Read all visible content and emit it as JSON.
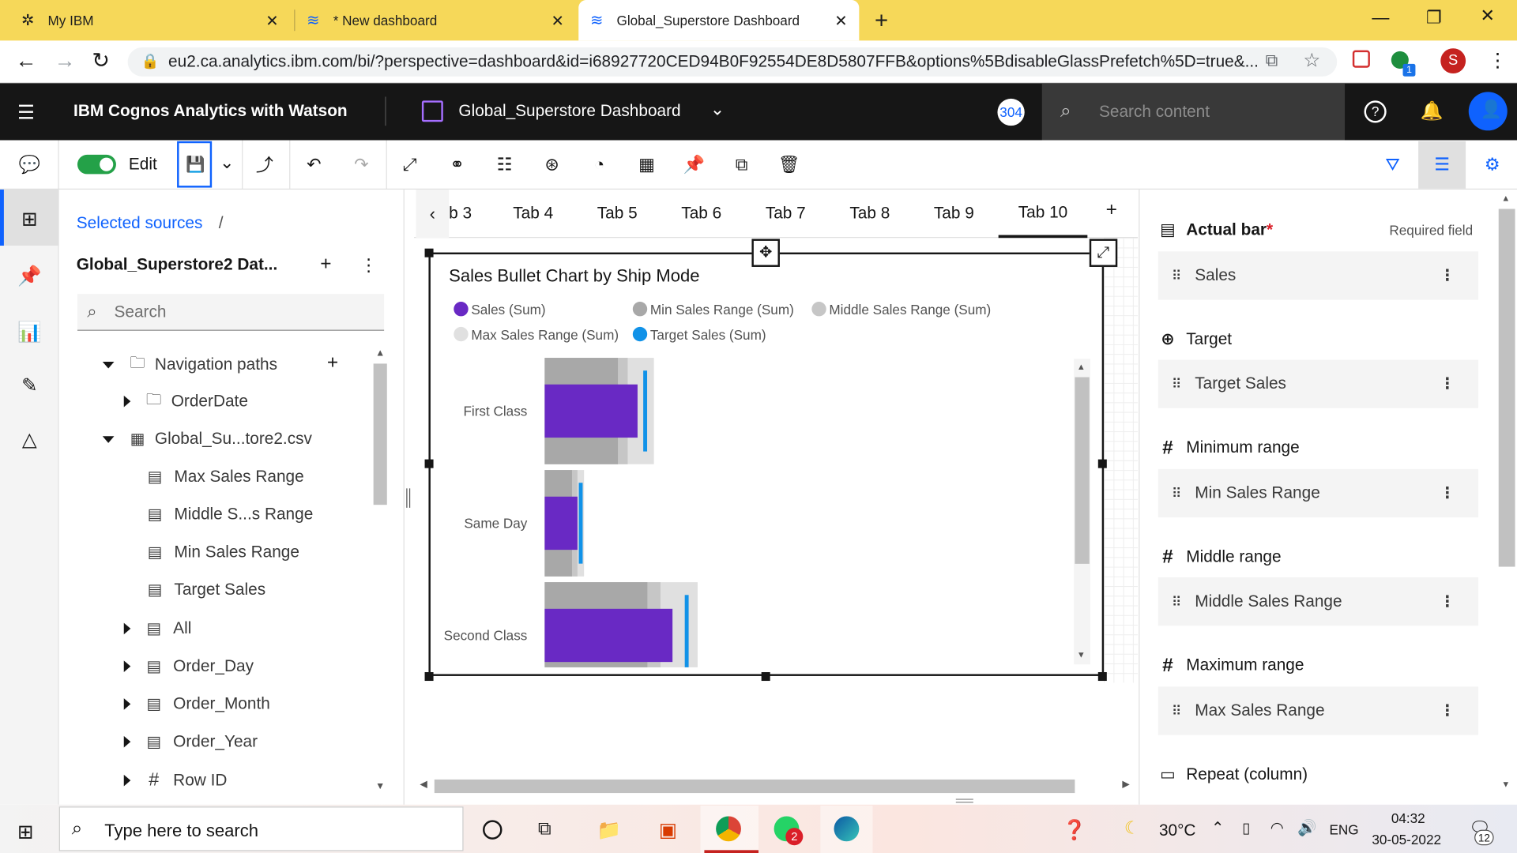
{
  "browser": {
    "tabs": [
      {
        "title": "My IBM"
      },
      {
        "title": "* New dashboard"
      },
      {
        "title": "Global_Superstore Dashboard"
      }
    ],
    "url": "eu2.ca.analytics.ibm.com/bi/?perspective=dashboard&id=i68927720CED94B0F92554DE8D5807FFB&options%5BdisableGlassPrefetch%5D=true&...",
    "profile_initial": "S",
    "extension_badge": "1"
  },
  "app": {
    "product_name": "IBM Cognos Analytics with Watson",
    "dashboard_title": "Global_Superstore Dashboard",
    "user_badge": "304",
    "search_placeholder": "Search content"
  },
  "toolbar": {
    "edit_label": "Edit",
    "edit_toggle_on": true
  },
  "data_panel": {
    "breadcrumb": "Selected sources",
    "breadcrumb_sep": "/",
    "source_title": "Global_Superstore2 Dat...",
    "search_placeholder": "Search",
    "tree": [
      {
        "label": "Navigation paths",
        "icon": "folder-icon",
        "expanded": true,
        "level": 0
      },
      {
        "label": "OrderDate",
        "icon": "folder-icon",
        "expanded": false,
        "level": 1
      },
      {
        "label": "Global_Su...tore2.csv",
        "icon": "table-icon",
        "expanded": true,
        "level": 0
      },
      {
        "label": "Max Sales Range",
        "icon": "calc-icon",
        "level": 2
      },
      {
        "label": "Middle S...s Range",
        "icon": "calc-icon",
        "level": 2
      },
      {
        "label": "Min Sales Range",
        "icon": "calc-icon",
        "level": 2
      },
      {
        "label": "Target Sales",
        "icon": "calc-icon",
        "level": 2
      },
      {
        "label": "All",
        "icon": "calc-icon",
        "expanded": false,
        "level": 1
      },
      {
        "label": "Order_Day",
        "icon": "calc-icon",
        "expanded": false,
        "level": 1
      },
      {
        "label": "Order_Month",
        "icon": "calc-icon",
        "expanded": false,
        "level": 1
      },
      {
        "label": "Order_Year",
        "icon": "calc-icon",
        "expanded": false,
        "level": 1
      },
      {
        "label": "Row ID",
        "icon": "hash-icon",
        "expanded": false,
        "level": 1
      }
    ]
  },
  "dashboard_tabs": {
    "partial_first": "b 3",
    "tabs": [
      "Tab 4",
      "Tab 5",
      "Tab 6",
      "Tab 7",
      "Tab 8",
      "Tab 9",
      "Tab 10"
    ],
    "active": "Tab 10"
  },
  "widget": {
    "title": "Sales Bullet Chart by Ship Mode",
    "legend": [
      {
        "label": "Sales (Sum)",
        "color": "#6929c4"
      },
      {
        "label": "Min Sales Range (Sum)",
        "color": "#a8a8a8"
      },
      {
        "label": "Middle Sales Range (Sum)",
        "color": "#c6c6c6"
      },
      {
        "label": "Max Sales Range (Sum)",
        "color": "#e0e0e0"
      },
      {
        "label": "Target Sales (Sum)",
        "color": "#1192e8"
      }
    ]
  },
  "chart_data": {
    "type": "bar",
    "subtype": "bullet",
    "orientation": "horizontal",
    "title": "Sales Bullet Chart by Ship Mode",
    "categories": [
      "First Class",
      "Same Day",
      "Second Class"
    ],
    "series": [
      {
        "name": "Sales (Sum)",
        "values": [
          0.85,
          0.3,
          1.17
        ]
      },
      {
        "name": "Min Sales Range (Sum)",
        "values": [
          0.67,
          0.25,
          0.94
        ]
      },
      {
        "name": "Middle Sales Range (Sum)",
        "values": [
          0.76,
          0.3,
          1.06
        ]
      },
      {
        "name": "Max Sales Range (Sum)",
        "values": [
          1.0,
          0.36,
          1.4
        ]
      },
      {
        "name": "Target Sales (Sum)",
        "values": [
          0.92,
          0.33,
          1.3
        ]
      }
    ],
    "xlim": [
      0,
      4.8
    ],
    "axis_ticks_visible": false,
    "legend_position": "top"
  },
  "properties": {
    "actual_bar_label": "Actual bar",
    "required_marker": "*",
    "required_field": "Required field",
    "slots": [
      {
        "header": "Actual bar",
        "value": "Sales",
        "icon": "bar-icon"
      },
      {
        "header": "Target",
        "value": "Target Sales",
        "icon": "target-icon"
      },
      {
        "header": "Minimum range",
        "value": "Min Sales Range",
        "icon": "hash-icon"
      },
      {
        "header": "Middle range",
        "value": "Middle Sales Range",
        "icon": "hash-icon"
      },
      {
        "header": "Maximum range",
        "value": "Max Sales Range",
        "icon": "hash-icon"
      }
    ],
    "repeat_label": "Repeat (column)"
  },
  "taskbar": {
    "search_placeholder": "Type here to search",
    "temperature": "30°C",
    "language": "ENG",
    "time": "04:32",
    "date": "30-05-2022",
    "whatsapp_badge": "2",
    "notification_count": "12"
  }
}
